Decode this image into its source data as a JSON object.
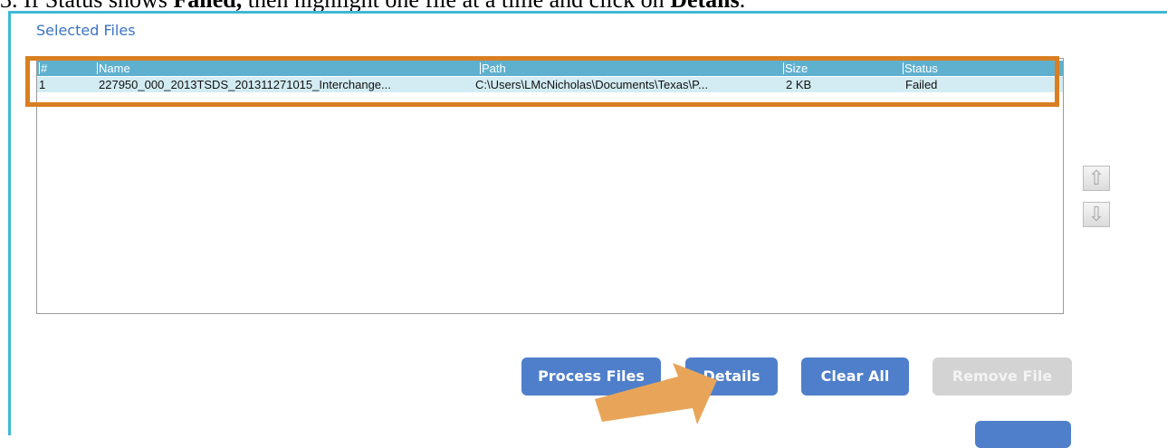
{
  "instruction": {
    "prefix": "3.   If Status shows ",
    "status_word": "Failed,",
    "middle": " then highlight one file at a time and click on ",
    "button_word": "Details",
    "suffix": "."
  },
  "panel": {
    "title": "Selected Files"
  },
  "table": {
    "columns": [
      "#",
      "Name",
      "Path",
      "Size",
      "Status"
    ],
    "rows": [
      {
        "num": "1",
        "name": "227950_000_2013TSDS_201311271015_Interchange...",
        "path": "C:\\Users\\LMcNicholas\\Documents\\Texas\\P...",
        "size": "2 KB",
        "status": "Failed"
      }
    ]
  },
  "buttons": {
    "process_files": "Process Files",
    "details": "Details",
    "clear_all": "Clear All",
    "remove_file": "Remove File"
  },
  "icons": {
    "move_up": "arrow-up-icon",
    "move_down": "arrow-down-icon"
  },
  "colors": {
    "accent": "#3fb8d4",
    "header": "#5fb0cf",
    "highlight": "#d97f22",
    "button": "#4f7fca",
    "pointer": "#e8a55a"
  }
}
